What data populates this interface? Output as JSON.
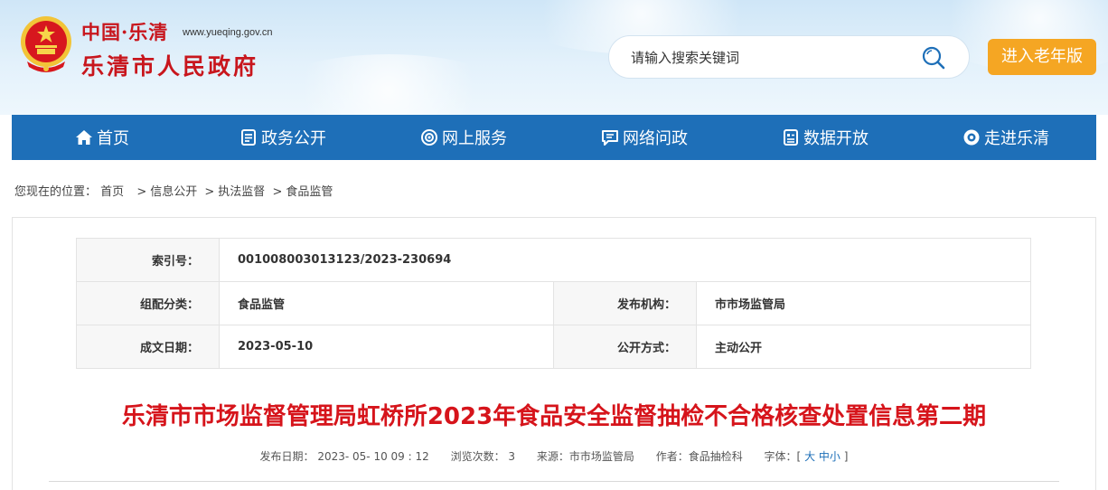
{
  "header": {
    "site_cn": "中国·乐清",
    "site_url": "www.yueqing.gov.cn",
    "site_name": "乐清市人民政府",
    "search_placeholder": "请输入搜索关键词",
    "elder_button": "进入老年版",
    "colors": {
      "brand_red": "#c8161d",
      "elder_orange": "#f5a623"
    }
  },
  "nav": {
    "color": "#1e6fb8",
    "items": [
      {
        "label": "首页",
        "icon": "home-icon"
      },
      {
        "label": "政务公开",
        "icon": "document-icon"
      },
      {
        "label": "网上服务",
        "icon": "service-icon"
      },
      {
        "label": "网络问政",
        "icon": "message-icon"
      },
      {
        "label": "数据开放",
        "icon": "data-icon"
      },
      {
        "label": "走进乐清",
        "icon": "eye-icon"
      }
    ]
  },
  "breadcrumb": {
    "prefix": "您现在的位置：",
    "items": [
      "首页",
      "信息公开",
      "执法监督",
      "食品监管"
    ],
    "separator": ">"
  },
  "meta": {
    "index_label": "索引号：",
    "index_value": "001008003013123/2023-230694",
    "category_label": "组配分类：",
    "category_value": "食品监管",
    "publisher_label": "发布机构：",
    "publisher_value": "市市场监管局",
    "date_label": "成文日期：",
    "date_value": "2023-05-10",
    "open_label": "公开方式：",
    "open_value": "主动公开"
  },
  "article": {
    "title": "乐清市市场监督管理局虹桥所2023年食品安全监督抽检不合格核查处置信息第二期",
    "publish_date": "发布日期： 2023- 05- 10 09 : 12",
    "views": "浏览次数： 3",
    "source": "来源：市市场监管局",
    "author": "作者：食品抽检科",
    "font_label": "字体：[",
    "font_large": "大",
    "font_medium": "中",
    "font_small": "小",
    "font_close": "]",
    "title_color": "#d6141b"
  }
}
